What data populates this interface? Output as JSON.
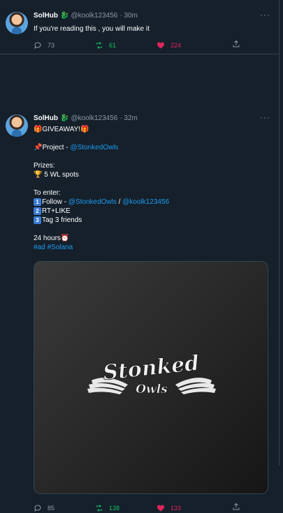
{
  "tweets": [
    {
      "name": "SolHub",
      "badge": "🐉",
      "handle": "@koolk123456",
      "time": "· 30m",
      "text": "If you're reading this ,  you will make it",
      "replies": "73",
      "retweets": "61",
      "likes": "224"
    },
    {
      "name": "SolHub",
      "badge": "🐉",
      "handle": "@koolk123456",
      "time": "· 32m",
      "giveaway": "🎁GIVEAWAY!🎁",
      "project_prefix": "📌Project -  ",
      "project_link": "@StonkedOwls",
      "prizes_label": "Prizes:",
      "prize": "🏆 5 WL spots",
      "enter_label": "To enter:",
      "step1_num": "1",
      "step1_text": "Follow - ",
      "step1_link1": "@StonkedOwls",
      "step1_sep": " / ",
      "step1_link2": "@koolk123456",
      "step2_num": "2",
      "step2_text": "RT+LIKE",
      "step3_num": "3",
      "step3_text": "Tag 3 friends",
      "hours": "24 hours⏰",
      "tags": "#ad #Solana",
      "logo_top": "Stonked",
      "logo_bottom": "Owls",
      "replies": "85",
      "retweets": "138",
      "likes": "133"
    }
  ],
  "more_label": "···",
  "colors": {
    "background": "#15202b",
    "link": "#1d9bf0",
    "retweet": "#17bf63",
    "like": "#e0245e",
    "muted": "#8899a6"
  },
  "icons": {
    "reply": "reply-icon",
    "retweet": "retweet-icon",
    "like": "heart-icon",
    "share": "share-icon",
    "more": "more-icon"
  }
}
